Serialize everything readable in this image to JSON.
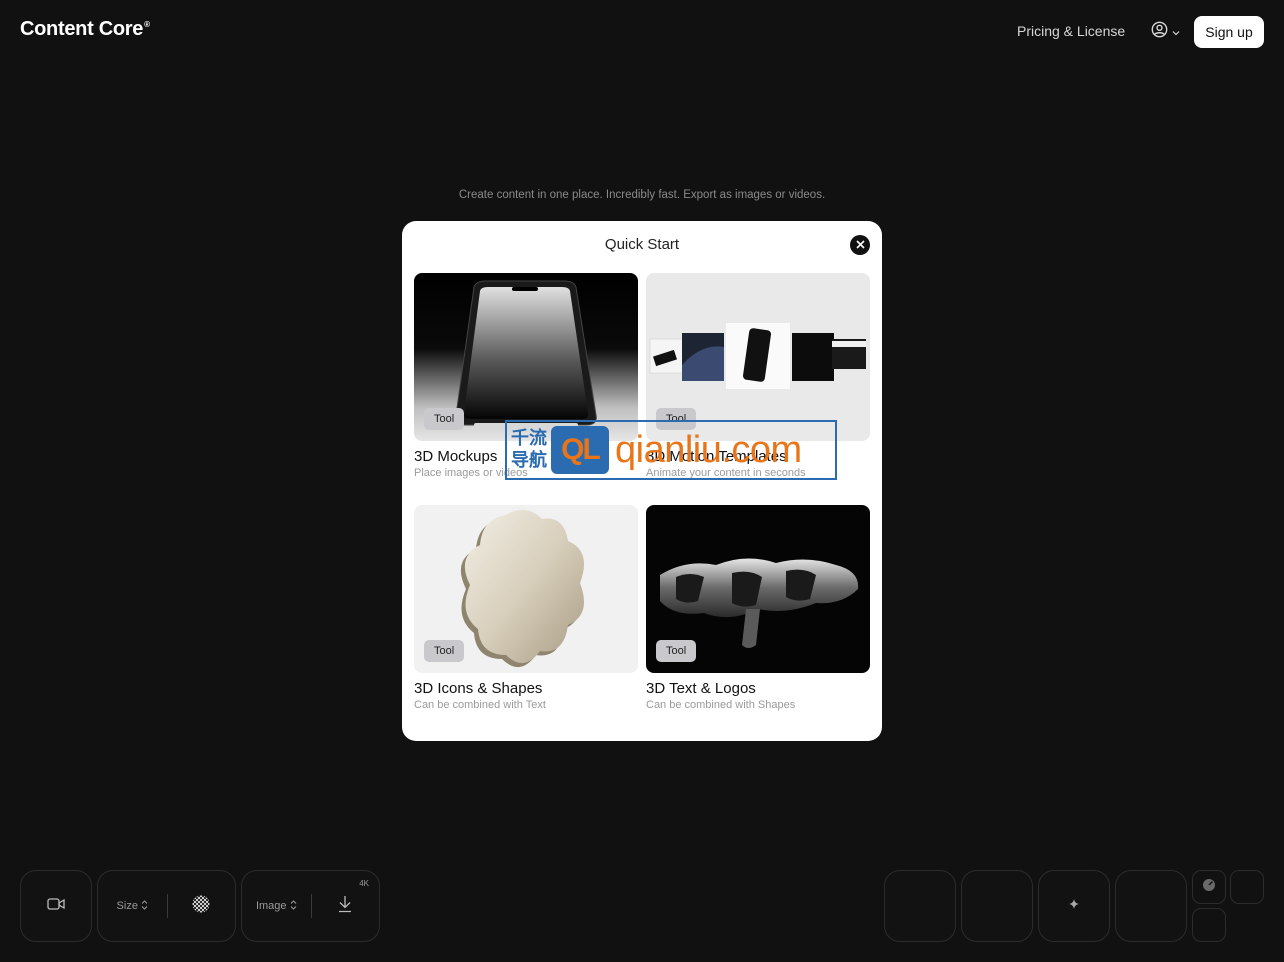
{
  "header": {
    "logo": "Content Core",
    "logo_mark": "®",
    "nav_pricing": "Pricing & License",
    "account_icon": "user-circle-icon",
    "signup": "Sign up"
  },
  "tagline": "Create content in one place. Incredibly fast. Export as images or videos.",
  "modal": {
    "title": "Quick Start",
    "close_icon": "close-icon",
    "cards": [
      {
        "tag": "Tool",
        "title": "3D Mockups",
        "desc": "Place images or videos"
      },
      {
        "tag": "Tool",
        "title": "3D Motion Templates",
        "desc": "Animate your content in seconds"
      },
      {
        "tag": "Tool",
        "title": "3D Icons & Shapes",
        "desc": "Can be combined with Text"
      },
      {
        "tag": "Tool",
        "title": "3D Text & Logos",
        "desc": "Can be combined with Shapes"
      }
    ]
  },
  "watermark": {
    "cn_top": "千流",
    "cn_bottom": "导航",
    "logo": "QL",
    "url": "qianliu.com"
  },
  "toolbar": {
    "video_icon": "video-camera-icon",
    "size_label": "Size",
    "transparency_icon": "checkerboard-icon",
    "image_label": "Image",
    "download_icon": "download-icon",
    "resolution_badge": "4K",
    "sparkle_icon": "sparkle-icon",
    "dial_icon": "dial-icon"
  },
  "colors": {
    "background": "#111111",
    "modal": "#ffffff",
    "tag": "#c9c9cd",
    "watermark_blue": "#2b6cb0",
    "watermark_orange": "#e8751a"
  }
}
